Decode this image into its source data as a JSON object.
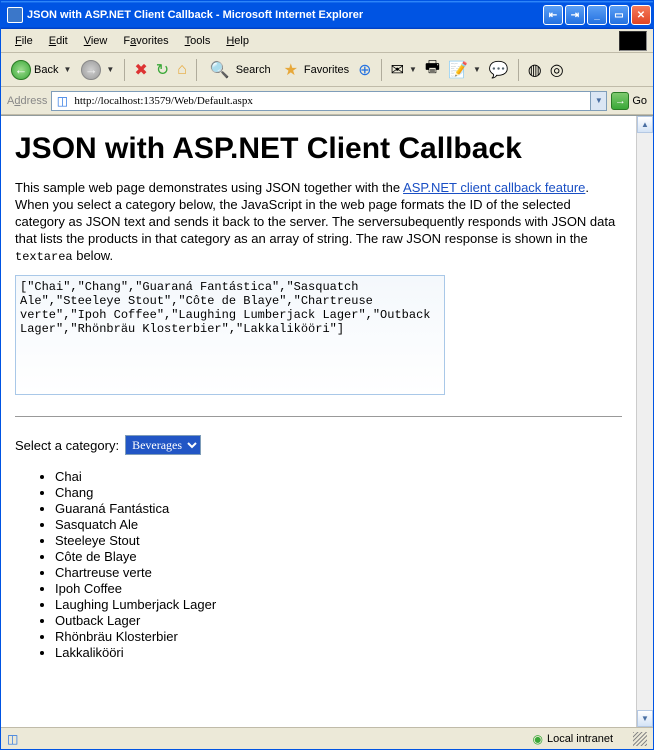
{
  "window": {
    "title": "JSON with ASP.NET Client Callback - Microsoft Internet Explorer"
  },
  "menubar": {
    "file": "File",
    "edit": "Edit",
    "view": "View",
    "favorites": "Favorites",
    "tools": "Tools",
    "help": "Help"
  },
  "toolbar": {
    "back": "Back",
    "search": "Search",
    "favorites": "Favorites"
  },
  "addressbar": {
    "label": "Address",
    "url": "http://localhost:13579/Web/Default.aspx",
    "go": "Go"
  },
  "page": {
    "heading": "JSON with ASP.NET Client Callback",
    "para_before_link": "This sample web page demonstrates using JSON together with the ",
    "link_text": "ASP.NET client callback feature",
    "para_after_link": ". When you select a category below, the JavaScript in the web page formats the ID of the selected category as JSON text and sends it back to the server. The serversubequently responds with JSON data that lists the products in that category as an array of string. The raw JSON response is shown in the ",
    "code_word": "textarea",
    "para_tail": " below.",
    "json_response": "[\"Chai\",\"Chang\",\"Guaraná Fantástica\",\"Sasquatch Ale\",\"Steeleye Stout\",\"Côte de Blaye\",\"Chartreuse verte\",\"Ipoh Coffee\",\"Laughing Lumberjack Lager\",\"Outback Lager\",\"Rhönbräu Klosterbier\",\"Lakkalikööri\"]",
    "select_label": "Select a category:",
    "selected_category": "Beverages",
    "products": [
      "Chai",
      "Chang",
      "Guaraná Fantástica",
      "Sasquatch Ale",
      "Steeleye Stout",
      "Côte de Blaye",
      "Chartreuse verte",
      "Ipoh Coffee",
      "Laughing Lumberjack Lager",
      "Outback Lager",
      "Rhönbräu Klosterbier",
      "Lakkalikööri"
    ]
  },
  "statusbar": {
    "zone": "Local intranet"
  }
}
